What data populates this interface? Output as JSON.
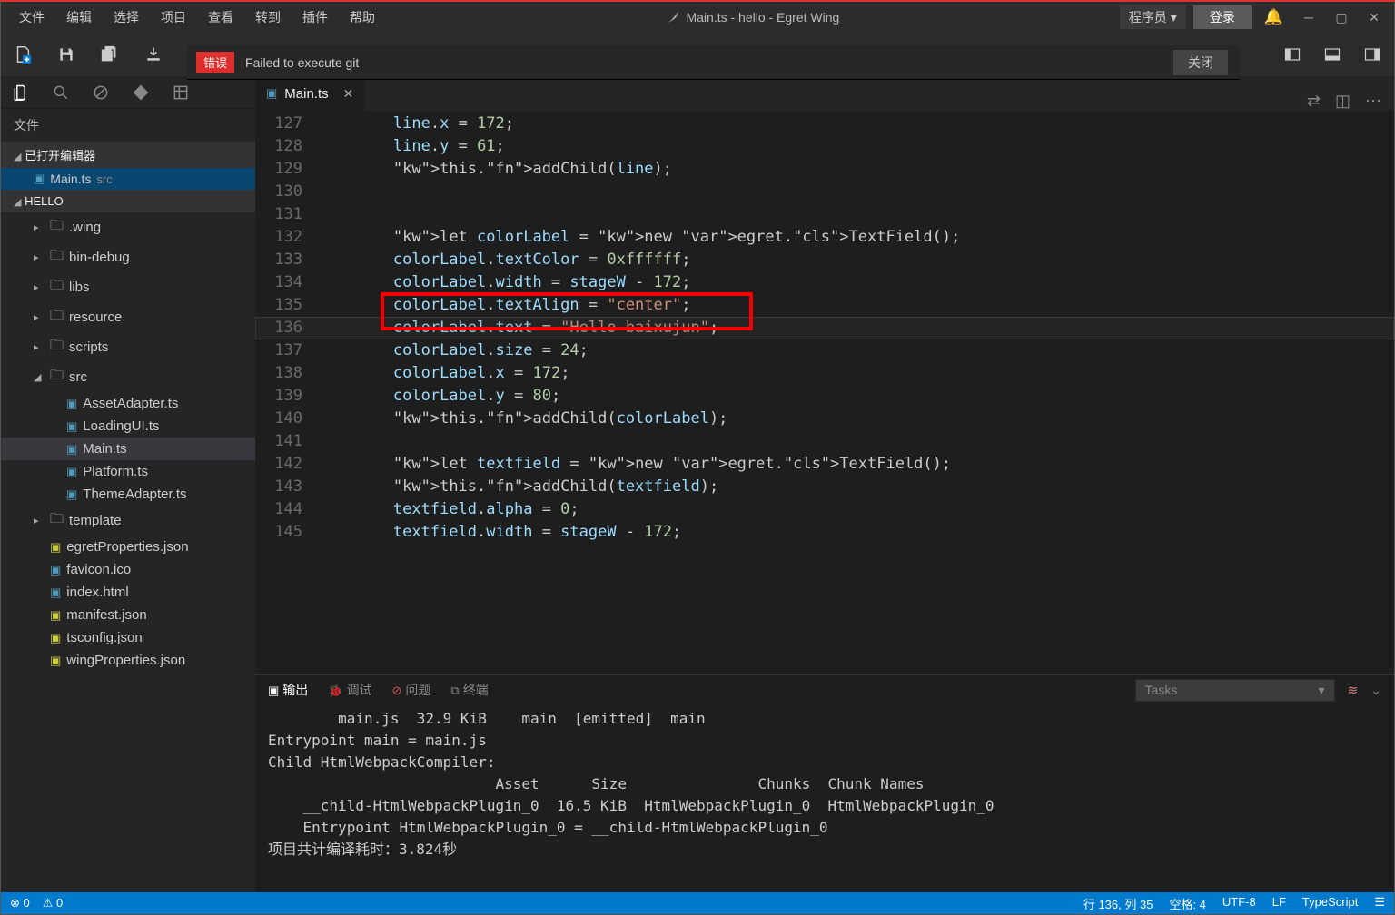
{
  "menu": [
    "文件",
    "编辑",
    "选择",
    "项目",
    "查看",
    "转到",
    "插件",
    "帮助"
  ],
  "title": "Main.ts - hello - Egret Wing",
  "role": "程序员",
  "login": "登录",
  "notif": {
    "badge": "错误",
    "msg": "Failed to execute git",
    "close": "关闭"
  },
  "panelTitle": "文件",
  "sectionOpen": "已打开编辑器",
  "openFile": {
    "name": "Main.ts",
    "dir": "src"
  },
  "projName": "HELLO",
  "tree": [
    {
      "t": "folder",
      "name": ".wing",
      "ind": 1,
      "exp": false
    },
    {
      "t": "folder",
      "name": "bin-debug",
      "ind": 1,
      "exp": false
    },
    {
      "t": "folder",
      "name": "libs",
      "ind": 1,
      "exp": false
    },
    {
      "t": "folder",
      "name": "resource",
      "ind": 1,
      "exp": false
    },
    {
      "t": "folder",
      "name": "scripts",
      "ind": 1,
      "exp": false
    },
    {
      "t": "folder",
      "name": "src",
      "ind": 1,
      "exp": true
    },
    {
      "t": "ts",
      "name": "AssetAdapter.ts",
      "ind": 2
    },
    {
      "t": "ts",
      "name": "LoadingUI.ts",
      "ind": 2
    },
    {
      "t": "ts",
      "name": "Main.ts",
      "ind": 2,
      "sel": true
    },
    {
      "t": "ts",
      "name": "Platform.ts",
      "ind": 2
    },
    {
      "t": "ts",
      "name": "ThemeAdapter.ts",
      "ind": 2
    },
    {
      "t": "folder",
      "name": "template",
      "ind": 1,
      "exp": false
    },
    {
      "t": "json",
      "name": "egretProperties.json",
      "ind": 1
    },
    {
      "t": "ico",
      "name": "favicon.ico",
      "ind": 1
    },
    {
      "t": "html",
      "name": "index.html",
      "ind": 1
    },
    {
      "t": "json",
      "name": "manifest.json",
      "ind": 1
    },
    {
      "t": "json",
      "name": "tsconfig.json",
      "ind": 1
    },
    {
      "t": "json",
      "name": "wingProperties.json",
      "ind": 1
    }
  ],
  "tabFile": "Main.ts",
  "code": {
    "start": 127,
    "lines": [
      "        line.x = 172;",
      "        line.y = 61;",
      "        this.addChild(line);",
      "",
      "",
      "        let colorLabel = new egret.TextField();",
      "        colorLabel.textColor = 0xffffff;",
      "        colorLabel.width = stageW - 172;",
      "        colorLabel.textAlign = \"center\";",
      "        colorLabel.text = \"Hello baixujun\";",
      "        colorLabel.size = 24;",
      "        colorLabel.x = 172;",
      "        colorLabel.y = 80;",
      "        this.addChild(colorLabel);",
      "",
      "        let textfield = new egret.TextField();",
      "        this.addChild(textfield);",
      "        textfield.alpha = 0;",
      "        textfield.width = stageW - 172;"
    ],
    "current": 136
  },
  "panelTabs": {
    "output": "输出",
    "debug": "调试",
    "problems": "问题",
    "terminal": "终端",
    "task": "Tasks"
  },
  "console": "        main.js  32.9 KiB    main  [emitted]  main\nEntrypoint main = main.js\nChild HtmlWebpackCompiler:\n                          Asset      Size               Chunks  Chunk Names\n    __child-HtmlWebpackPlugin_0  16.5 KiB  HtmlWebpackPlugin_0  HtmlWebpackPlugin_0\n    Entrypoint HtmlWebpackPlugin_0 = __child-HtmlWebpackPlugin_0\n项目共计编译耗时：3.824秒",
  "status": {
    "err": "0",
    "warn": "0",
    "pos": "行 136, 列 35",
    "spaces": "空格: 4",
    "enc": "UTF-8",
    "eol": "LF",
    "lang": "TypeScript"
  }
}
